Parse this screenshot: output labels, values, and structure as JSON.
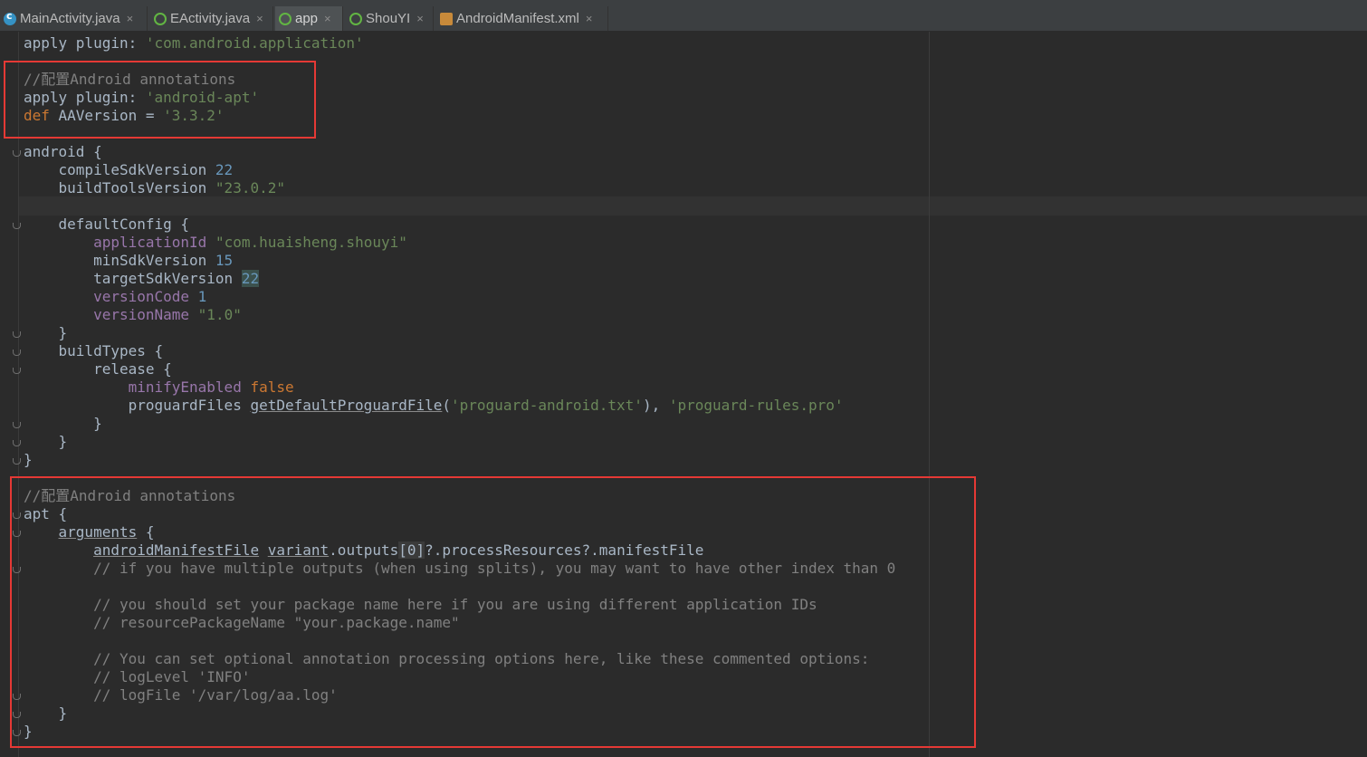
{
  "tabs": [
    {
      "label": "MainActivity.java",
      "icon": "class-icon",
      "close": "×"
    },
    {
      "label": "EActivity.java",
      "icon": "activity-icon",
      "close": "×"
    },
    {
      "label": "app",
      "icon": "gradle-icon",
      "close": "×",
      "active": true
    },
    {
      "label": "ShouYI",
      "icon": "gradle-icon",
      "close": "×"
    },
    {
      "label": "AndroidManifest.xml",
      "icon": "xml-icon",
      "close": "×"
    }
  ],
  "code": {
    "l1_a": "apply plugin: ",
    "l1_b": "'com.android.application'",
    "l3": "//配置Android annotations",
    "l4_a": "apply plugin: ",
    "l4_b": "'android-apt'",
    "l5_a": "def ",
    "l5_b": "AAVersion = ",
    "l5_c": "'3.3.2'",
    "l7": "android {",
    "l8_a": "    compileSdkVersion ",
    "l8_b": "22",
    "l9_a": "    buildToolsVersion ",
    "l9_b": "\"23.0.2\"",
    "l11": "    defaultConfig {",
    "l12_a": "        ",
    "l12_b": "applicationId",
    "l12_c": " ",
    "l12_d": "\"com.huaisheng.shouyi\"",
    "l13_a": "        minSdkVersion ",
    "l13_b": "15",
    "l14_a": "        targetSdkVersion ",
    "l14_b": "22",
    "l15_a": "        ",
    "l15_b": "versionCode",
    "l15_c": " ",
    "l15_d": "1",
    "l16_a": "        ",
    "l16_b": "versionName",
    "l16_c": " ",
    "l16_d": "\"1.0\"",
    "l17": "    }",
    "l18": "    buildTypes {",
    "l19": "        release {",
    "l20_a": "            ",
    "l20_b": "minifyEnabled",
    "l20_c": " ",
    "l20_d": "false",
    "l21_a": "            proguardFiles ",
    "l21_b": "getDefaultProguardFile",
    "l21_c": "(",
    "l21_d": "'proguard-android.txt'",
    "l21_e": "), ",
    "l21_f": "'proguard-rules.pro'",
    "l22": "        }",
    "l23": "    }",
    "l24": "}",
    "l26": "//配置Android annotations",
    "l27": "apt {",
    "l28_a": "    ",
    "l28_b": "arguments",
    "l28_c": " {",
    "l29_a": "        ",
    "l29_b": "androidManifestFile",
    "l29_c": " ",
    "l29_d": "variant",
    "l29_e": ".outputs",
    "l29_f": "[0]",
    "l29_g": "?.processResources?.manifestFile",
    "l30": "        // if you have multiple outputs (when using splits), you may want to have other index than 0",
    "l32": "        // you should set your package name here if you are using different application IDs",
    "l33": "        // resourcePackageName \"your.package.name\"",
    "l35": "        // You can set optional annotation processing options here, like these commented options:",
    "l36": "        // logLevel 'INFO'",
    "l37": "        // logFile '/var/log/aa.log'",
    "l38": "    }",
    "l39": "}"
  },
  "colors": {
    "background": "#2b2b2b",
    "keyword": "#cc7832",
    "string": "#6a8759",
    "number": "#6897bb",
    "property": "#9876aa",
    "comment": "#808080",
    "highlight_box": "#e53935"
  }
}
